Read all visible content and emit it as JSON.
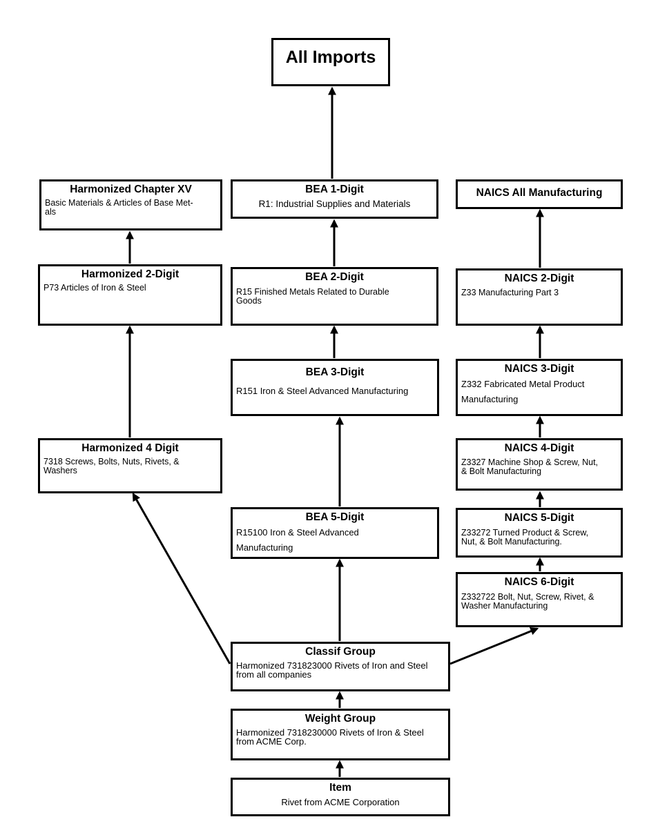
{
  "diagram": {
    "root": {
      "title": "All Imports"
    },
    "harmonized": [
      {
        "id": "hts-chapter",
        "title": "Harmonized Chapter XV",
        "desc": "Basic Materials & Articles of Base Met-\nals"
      },
      {
        "id": "hts-2",
        "title": "Harmonized 2-Digit",
        "desc": "P73 Articles of Iron & Steel"
      },
      {
        "id": "hts-4",
        "title": "Harmonized 4 Digit",
        "desc": "7318 Screws, Bolts, Nuts, Rivets, &\nWashers"
      }
    ],
    "bea": [
      {
        "id": "bea-1",
        "title": "BEA 1-Digit",
        "desc": "R1: Industrial Supplies and Materials"
      },
      {
        "id": "bea-2",
        "title": "BEA 2-Digit",
        "desc": "R15 Finished Metals Related to Durable\nGoods"
      },
      {
        "id": "bea-3",
        "title": "BEA 3-Digit",
        "desc": "R151 Iron & Steel Advanced Manufacturing"
      },
      {
        "id": "bea-5",
        "title": "BEA 5-Digit",
        "desc": "R15100 Iron & Steel Advanced\nManufacturing"
      }
    ],
    "naics": [
      {
        "id": "naics-all",
        "title": "NAICS All Manufacturing",
        "desc": ""
      },
      {
        "id": "naics-2",
        "title": "NAICS 2-Digit",
        "desc": "Z33 Manufacturing Part 3"
      },
      {
        "id": "naics-3",
        "title": "NAICS 3-Digit",
        "desc": "Z332 Fabricated Metal Product\nManufacturing"
      },
      {
        "id": "naics-4",
        "title": "NAICS 4-Digit",
        "desc": "Z3327 Machine Shop & Screw, Nut,\n& Bolt Manufacturing"
      },
      {
        "id": "naics-5",
        "title": "NAICS 5-Digit",
        "desc": "Z33272 Turned Product & Screw,\nNut, & Bolt Manufacturing."
      },
      {
        "id": "naics-6",
        "title": "NAICS 6-Digit",
        "desc": "Z332722 Bolt, Nut, Screw, Rivet, &\nWasher Manufacturing"
      }
    ],
    "bottom": [
      {
        "id": "classif-group",
        "title": "Classif Group",
        "desc": "Harmonized 731823000 Rivets of Iron and Steel\nfrom all companies"
      },
      {
        "id": "weight-group",
        "title": "Weight Group",
        "desc": "Harmonized 7318230000 Rivets of Iron & Steel\nfrom ACME Corp."
      },
      {
        "id": "item",
        "title": "Item",
        "desc": "Rivet from ACME Corporation"
      }
    ],
    "edges": [
      {
        "from": "bea-1",
        "to": "root"
      },
      {
        "from": "hts-2",
        "to": "hts-chapter"
      },
      {
        "from": "hts-4",
        "to": "hts-2"
      },
      {
        "from": "bea-2",
        "to": "bea-1"
      },
      {
        "from": "bea-3",
        "to": "bea-2"
      },
      {
        "from": "bea-5",
        "to": "bea-3"
      },
      {
        "from": "naics-2",
        "to": "naics-all"
      },
      {
        "from": "naics-3",
        "to": "naics-2"
      },
      {
        "from": "naics-4",
        "to": "naics-3"
      },
      {
        "from": "naics-5",
        "to": "naics-4"
      },
      {
        "from": "naics-6",
        "to": "naics-5"
      },
      {
        "from": "classif-group",
        "to": "hts-4"
      },
      {
        "from": "classif-group",
        "to": "bea-5"
      },
      {
        "from": "classif-group",
        "to": "naics-6"
      },
      {
        "from": "weight-group",
        "to": "classif-group"
      },
      {
        "from": "item",
        "to": "weight-group"
      }
    ]
  }
}
